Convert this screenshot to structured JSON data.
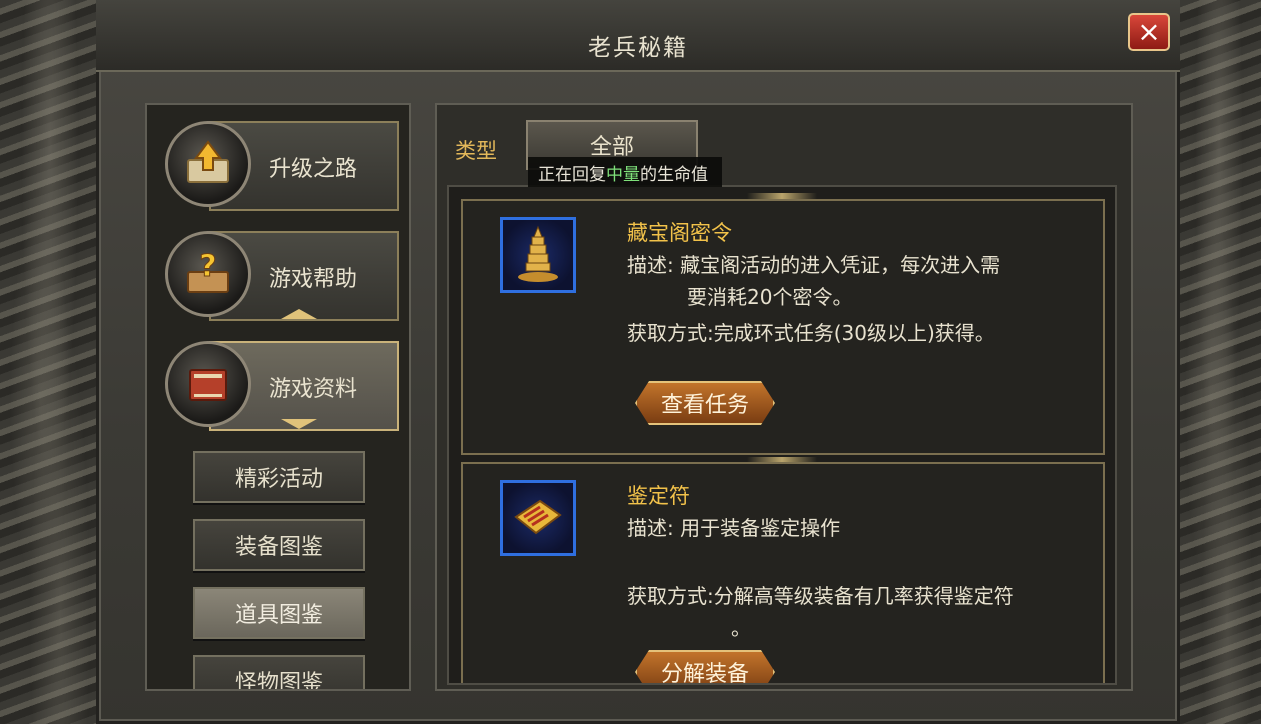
{
  "window": {
    "title": "老兵秘籍",
    "close_icon": "×"
  },
  "sidebar": {
    "categories": [
      {
        "label": "升级之路",
        "icon": "upgrade-book-icon"
      },
      {
        "label": "游戏帮助",
        "icon": "help-book-icon"
      },
      {
        "label": "游戏资料",
        "icon": "info-book-icon"
      }
    ],
    "sub_items": [
      "精彩活动",
      "装备图鉴",
      "道具图鉴",
      "怪物图鉴"
    ],
    "active_sub_item": "道具图鉴"
  },
  "filter": {
    "type_label": "类型",
    "type_value": "全部"
  },
  "tooltip": {
    "prefix": "正在回复",
    "highlight": "中量",
    "suffix": "的生命值"
  },
  "items": [
    {
      "name": "藏宝阁密令",
      "icon": "pagoda-icon",
      "desc_line1": "描述: 藏宝阁活动的进入凭证，每次进入需",
      "desc_line2": "要消耗20个密令。",
      "obtain": "获取方式:完成环式任务(30级以上)获得。",
      "button": "查看任务"
    },
    {
      "name": "鉴定符",
      "icon": "scroll-icon",
      "desc_line1": "描述: 用于装备鉴定操作",
      "obtain": "获取方式:分解高等级装备有几率获得鉴定符",
      "obtain_cont": "。",
      "button": "分解装备"
    }
  ],
  "colors": {
    "accent_gold": "#f2c24a",
    "type_label": "#e3b85a",
    "highlight_green": "#7fe07a"
  }
}
